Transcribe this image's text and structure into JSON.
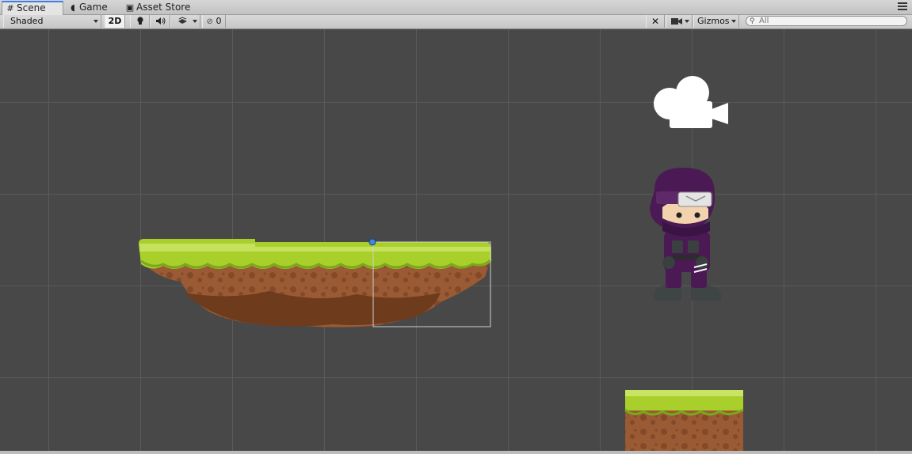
{
  "tabs": [
    {
      "label": "Scene",
      "icon": "grid-icon",
      "active": true
    },
    {
      "label": "Game",
      "icon": "pacman-icon",
      "active": false
    },
    {
      "label": "Asset Store",
      "icon": "store-icon",
      "active": false
    }
  ],
  "toolbar": {
    "draw_mode": "Shaded",
    "mode_2d": "2D",
    "hidden_count": "0",
    "gizmos_label": "Gizmos",
    "search_placeholder": "All"
  },
  "colors": {
    "scene_bg": "#484848",
    "grid_line": "#5a5a5a",
    "grass": "#a9cf2a",
    "dirt": "#9a5a34",
    "ninja_purple": "#4b1a55",
    "selection_outline": "#d0d0d0",
    "pivot": "#3d88e0"
  }
}
